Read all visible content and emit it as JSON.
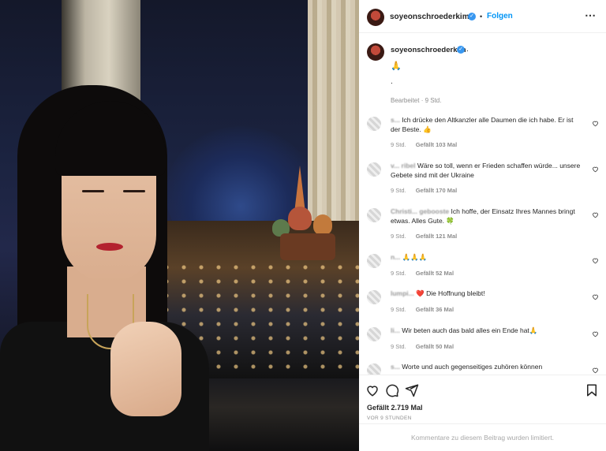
{
  "header": {
    "username": "soyeonschroederkim",
    "separator": "•",
    "follow_label": "Folgen",
    "more_icon": "⋯"
  },
  "caption": {
    "username": "soyeonschroederkim",
    "trailing_dot": ".",
    "emoji": "🙏",
    "line_dot": ".",
    "edited_meta": "Bearbeitet · 9 Std."
  },
  "comments": [
    {
      "user": "s...",
      "text": "Ich drücke den Altkanzler alle Daumen die ich habe. Er ist der Beste. 👍",
      "time": "9 Std.",
      "likes": "Gefällt 103 Mal"
    },
    {
      "user": "v... ribel",
      "text": "Wäre so toll, wenn er Frieden schaffen würde... unsere Gebete sind mit der Ukraine",
      "time": "9 Std.",
      "likes": "Gefällt 170 Mal"
    },
    {
      "user": "Christi... gebooste",
      "text": "Ich hoffe, der Einsatz Ihres Mannes bringt etwas. Alles Gute. 🍀",
      "time": "9 Std.",
      "likes": "Gefällt 121 Mal"
    },
    {
      "user": "n...",
      "text": "🙏🙏🙏",
      "time": "9 Std.",
      "likes": "Gefällt 52 Mal"
    },
    {
      "user": "lumpi...",
      "text": "❤️ Die Hoffnung bleibt!",
      "time": "9 Std.",
      "likes": "Gefällt 36 Mal"
    },
    {
      "user": "li...",
      "text": "Wir beten auch das bald alles ein Ende hat🙏",
      "time": "9 Std.",
      "likes": "Gefällt 50 Mal"
    },
    {
      "user": "s...",
      "text": "Worte und auch gegenseitiges zuhören können",
      "time": "",
      "likes": ""
    }
  ],
  "actions": {
    "likes_total": "Gefällt 2.719 Mal",
    "post_time": "VOR 9 STUNDEN",
    "comments_limited": "Kommentare zu diesem Beitrag wurden limitiert."
  },
  "colors": {
    "link_blue": "#0095f6",
    "verified_blue": "#3897f0",
    "meta_grey": "#8e8e8e"
  },
  "icons": [
    "heart-icon",
    "comment-icon",
    "share-icon",
    "bookmark-icon",
    "more-icon",
    "verified-icon"
  ]
}
